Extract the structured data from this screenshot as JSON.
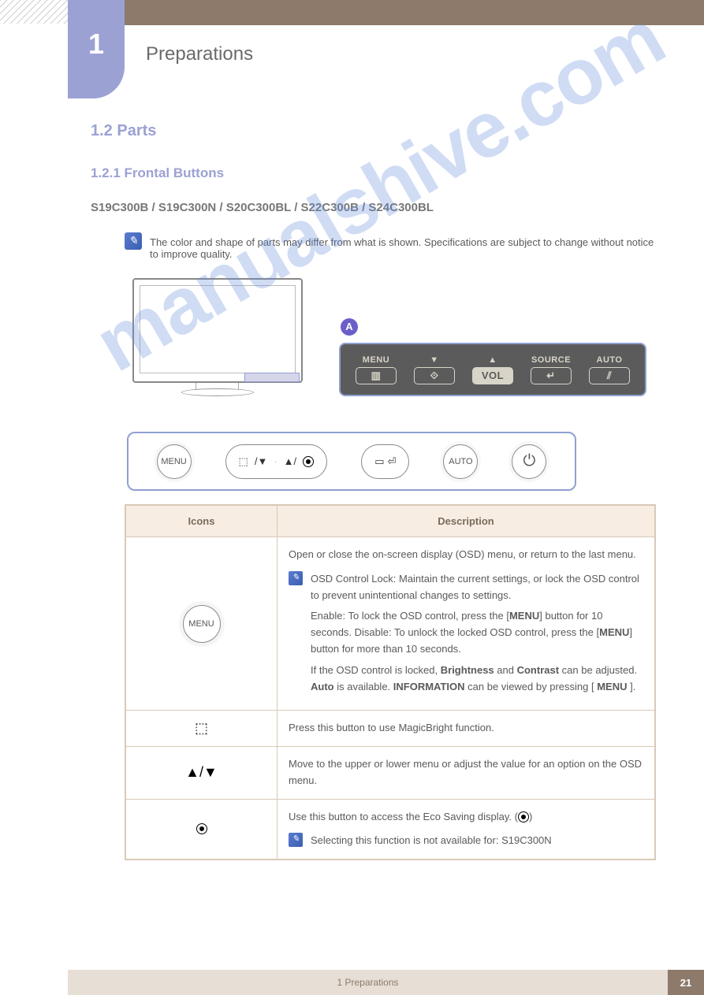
{
  "tab_number": "1",
  "chapter_title": "Preparations",
  "section_title": "1.2 Parts",
  "subsection_title": "1.2.1 Frontal Buttons",
  "model_line": "S19C300B / S19C300N / S20C300BL / S22C300B / S24C300BL",
  "note_text": "The color and shape of parts may differ from what is shown. Specifications are subject to change without notice to improve quality.",
  "marker_a": "A",
  "dark_panel": {
    "menu_label": "MENU",
    "source_label": "SOURCE",
    "auto_label": "AUTO",
    "vol_label": "VOL"
  },
  "light_panel": {
    "menu": "MENU",
    "auto": "AUTO"
  },
  "table": {
    "header_icons": "Icons",
    "header_desc": "Description",
    "row_menu": {
      "label": "MENU",
      "line1": "Open or close the on-screen display (OSD) menu, or return to the last menu.",
      "note_label": "OSD Control Lock: Maintain the current settings, or lock the OSD control to prevent unintentional changes to settings.",
      "note_body": "Enable: To lock the OSD control, press the [",
      "note_body2": "] button for 10 seconds. Disable: To unlock the locked OSD control, press the [",
      "note_body3": "] button for more than 10 seconds.",
      "note_footer": "If the OSD control is locked,",
      "note_footer2": " and ",
      "note_footer3": " can be adjusted. ",
      "note_footer4": " is available. ",
      "note_footer5": " can be viewed by pressing [",
      "note_footer6": "].",
      "brightness": "Brightness",
      "contrast": "Contrast",
      "auto": "Auto",
      "information": "INFORMATION",
      "menu_btn": "MENU"
    },
    "row_magicbright": "Press this button to use MagicBright function.",
    "row_arrows": "Move to the upper or lower menu or adjust the value for an option on the OSD menu.",
    "row_eco": {
      "line1": "Use this button to access the Eco Saving display. (",
      "line2": ")",
      "note": "Selecting this function is not available for: S19C300N"
    }
  },
  "footer_text": "1 Preparations",
  "page_number": "21"
}
